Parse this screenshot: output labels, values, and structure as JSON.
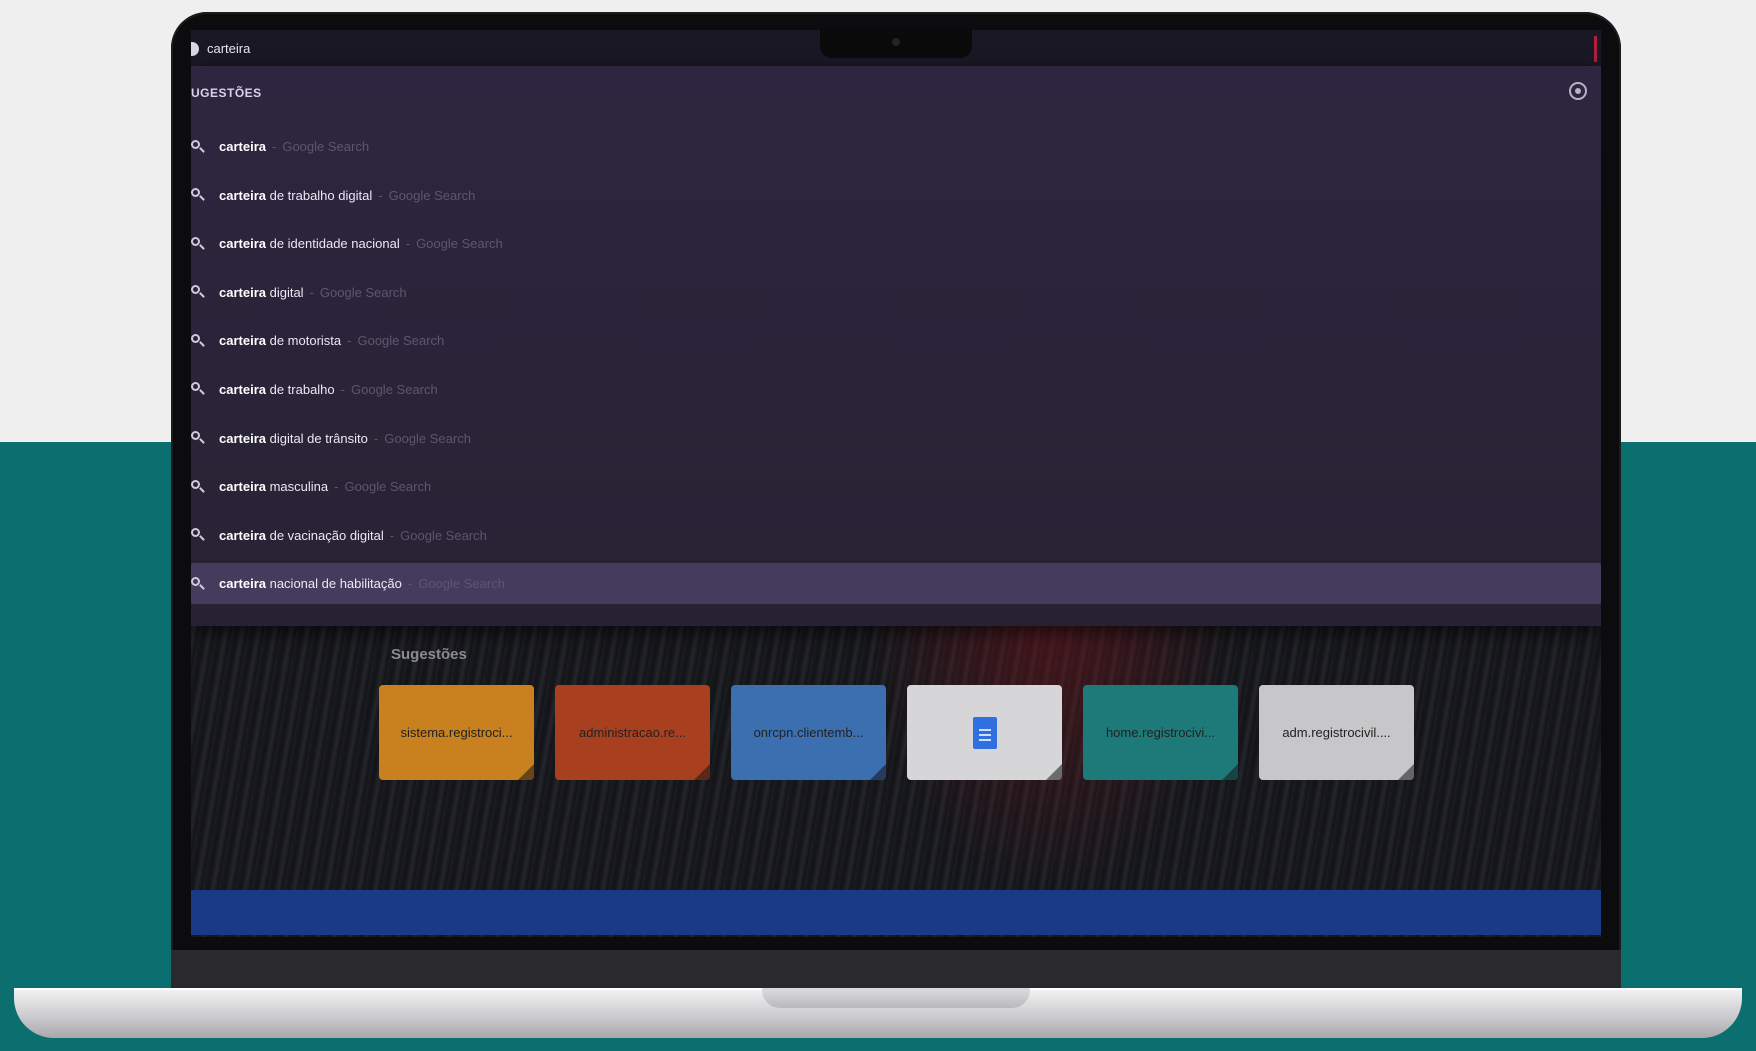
{
  "omnibox": {
    "value": "carteira"
  },
  "dropdown": {
    "header": "UGESTÕES",
    "settings_icon": "settings-icon",
    "items": [
      {
        "bold": "carteira",
        "rest": "",
        "meta": "Google Search"
      },
      {
        "bold": "carteira",
        "rest": " de trabalho digital",
        "meta": "Google Search"
      },
      {
        "bold": "carteira",
        "rest": " de identidade nacional",
        "meta": "Google Search"
      },
      {
        "bold": "carteira",
        "rest": " digital",
        "meta": "Google Search"
      },
      {
        "bold": "carteira",
        "rest": " de motorista",
        "meta": "Google Search"
      },
      {
        "bold": "carteira",
        "rest": " de trabalho",
        "meta": "Google Search"
      },
      {
        "bold": "carteira",
        "rest": " digital de trânsito",
        "meta": "Google Search"
      },
      {
        "bold": "carteira",
        "rest": " masculina",
        "meta": "Google Search"
      },
      {
        "bold": "carteira",
        "rest": " de vacinação digital",
        "meta": "Google Search"
      },
      {
        "bold": "carteira",
        "rest": " nacional de habilitação",
        "meta": "Google Search"
      }
    ],
    "separator": "-"
  },
  "newtab": {
    "title": "Sugestões",
    "tiles": [
      {
        "label": "sistema.registroci...",
        "color": "#c9801f"
      },
      {
        "label": "administracao.re...",
        "color": "#a8401f"
      },
      {
        "label": "onrcpn.clientemb...",
        "color": "#3b6fb0"
      },
      {
        "label": "",
        "color": "#d6d6d8",
        "icon": "google-docs-icon"
      },
      {
        "label": "home.registrocivi...",
        "color": "#1d7a78"
      },
      {
        "label": "adm.registrocivil....",
        "color": "#c7c7c9"
      }
    ],
    "next_icon": "›"
  },
  "colors": {
    "teal_background": "#0b6f70",
    "dropdown_background": "#2c2640",
    "active_row": "#453c5d",
    "bottom_bar": "#1a3a86"
  }
}
